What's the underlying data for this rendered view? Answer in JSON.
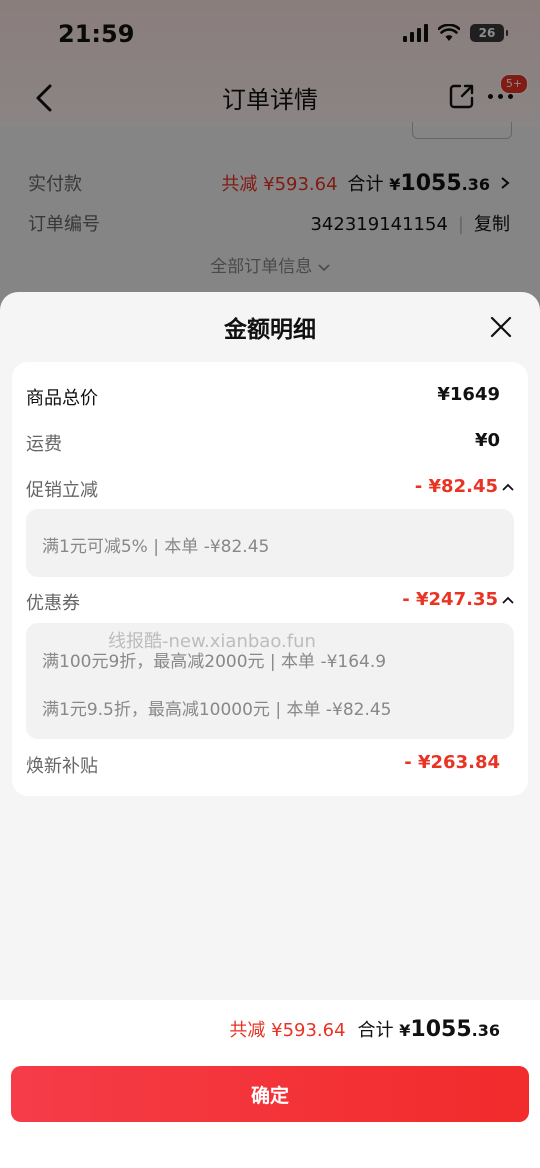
{
  "status_bar": {
    "time": "21:59",
    "battery": "26"
  },
  "nav": {
    "title": "订单详情",
    "badge": "5+"
  },
  "background": {
    "paid_label": "实付款",
    "total_reduce": "共减 ¥593.64",
    "total_label": "合计",
    "total_currency": "¥",
    "total_int": "1055",
    "total_dec": ".36",
    "order_no_label": "订单编号",
    "order_no": "342319141154",
    "copy_label": "复制",
    "all_info": "全部订单信息"
  },
  "sheet": {
    "title": "金额明细",
    "rows": {
      "goods_total": {
        "label": "商品总价",
        "value": "¥1649"
      },
      "shipping": {
        "label": "运费",
        "value": "¥0"
      },
      "promo": {
        "label": "促销立减",
        "value": "- ¥82.45",
        "details": [
          "满1元可减5% | 本单 -¥82.45"
        ]
      },
      "coupon": {
        "label": "优惠券",
        "value": "- ¥247.35",
        "details": [
          "满100元9折，最高减2000元 | 本单 -¥164.9",
          "满1元9.5折，最高减10000元 | 本单 -¥82.45"
        ]
      },
      "subsidy": {
        "label": "焕新补贴",
        "value": "- ¥263.84"
      }
    },
    "watermark": "线报酷-new.xianbao.fun"
  },
  "footer": {
    "total_reduce": "共减 ¥593.64",
    "total_label": "合计",
    "currency": "¥",
    "total_int": "1055",
    "total_dec": ".36",
    "confirm_label": "确定"
  },
  "colors": {
    "accent_red": "#e93323",
    "button_start": "#f53c48",
    "button_end": "#f22b2b"
  }
}
